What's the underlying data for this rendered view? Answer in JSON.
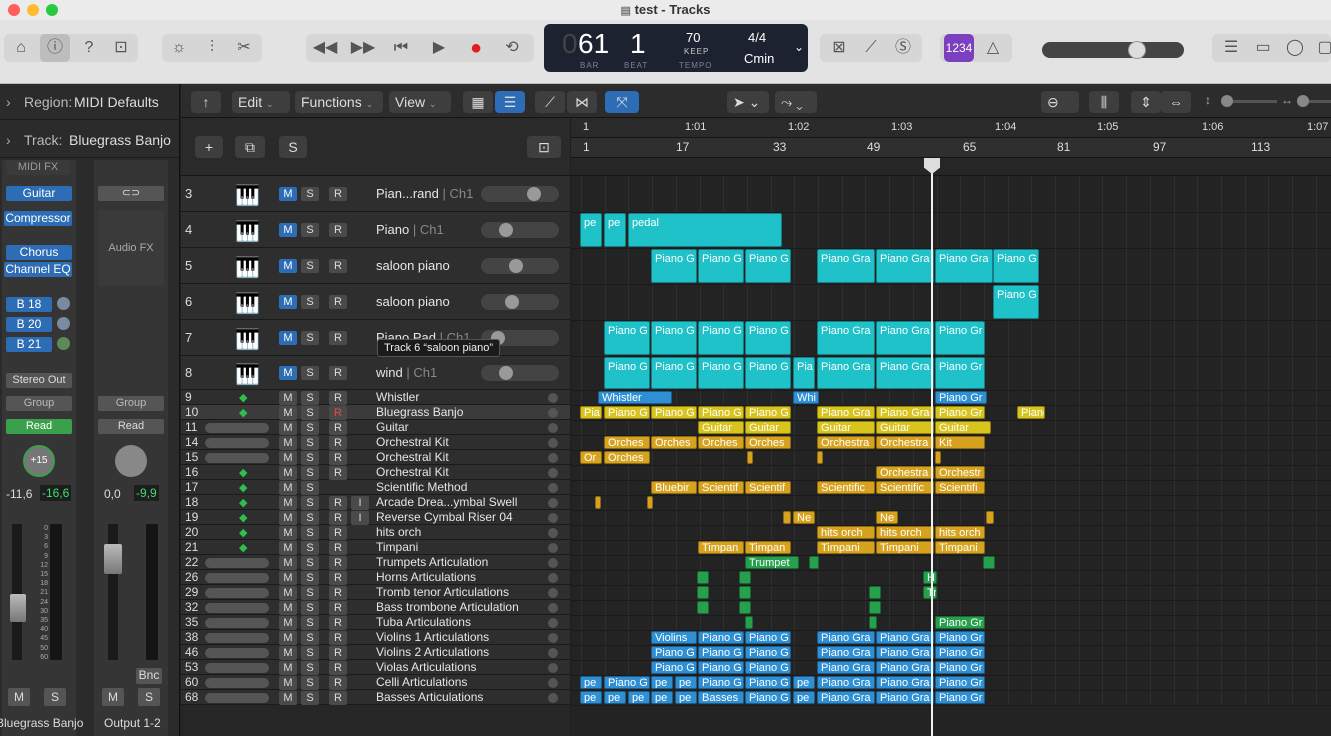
{
  "window": {
    "title": "test - Tracks"
  },
  "lcd": {
    "bar": "61",
    "beat": "1",
    "bar_lbl": "BAR",
    "beat_lbl": "BEAT",
    "tempo": "70",
    "keep": "KEEP",
    "tempo_lbl": "TEMPO",
    "sig": "4/4",
    "key": "Cmin",
    "prefix": "0"
  },
  "count_in": "1234",
  "inspector": {
    "region_lbl": "Region:",
    "region_val": "MIDI Defaults",
    "track_lbl": "Track:",
    "track_val": "Bluegrass Banjo",
    "midi_fx": "MIDI FX",
    "plugins": [
      "Guitar",
      "Compressor",
      "Chorus",
      "Channel EQ"
    ],
    "sends": [
      "B 18",
      "B 20",
      "B 21"
    ],
    "stereo_out": "Stereo Out",
    "group": "Group",
    "group2": "Group",
    "read": "Read",
    "read2": "Read",
    "pan": "+15",
    "vol_l": "-11,6",
    "vol_r": "-16,6",
    "vol2_l": "0,0",
    "vol2_r": "-9,9",
    "audio_fx": "Audio FX",
    "bnc": "Bnc",
    "m": "M",
    "s": "S",
    "strip1_name": "Bluegrass Banjo",
    "strip2_name": "Output 1-2",
    "db_scale": [
      "0",
      "3",
      "6",
      "9",
      "12",
      "15",
      "18",
      "21",
      "24",
      "30",
      "35",
      "40",
      "45",
      "50",
      "60"
    ]
  },
  "toolbar": {
    "edit": "Edit",
    "functions": "Functions",
    "view": "View"
  },
  "header_buttons": {
    "plus": "+",
    "s": "S"
  },
  "ruler_time": [
    "1",
    "1:01",
    "1:02",
    "1:03",
    "1:04",
    "1:05",
    "1:06",
    "1:07"
  ],
  "ruler_bars": [
    "1",
    "17",
    "33",
    "49",
    "65",
    "81",
    "97",
    "113"
  ],
  "tooltip": "Track 6 “saloon piano”",
  "btn": {
    "m": "M",
    "s": "S",
    "r": "R",
    "i": "I"
  },
  "tracks": [
    {
      "num": "3",
      "name": "Pian...rand",
      "ch": " | Ch1"
    },
    {
      "num": "4",
      "name": "Piano",
      "ch": " | Ch1"
    },
    {
      "num": "5",
      "name": "saloon piano",
      "ch": ""
    },
    {
      "num": "6",
      "name": "saloon piano",
      "ch": ""
    },
    {
      "num": "7",
      "name": "Piano Pad",
      "ch": " | Ch1"
    },
    {
      "num": "8",
      "name": "wind",
      "ch": " | Ch1"
    },
    {
      "num": "9",
      "name": "Whistler",
      "ch": ""
    },
    {
      "num": "10",
      "name": "Bluegrass Banjo",
      "ch": ""
    },
    {
      "num": "11",
      "name": "Guitar",
      "ch": ""
    },
    {
      "num": "14",
      "name": "Orchestral Kit",
      "ch": ""
    },
    {
      "num": "15",
      "name": "Orchestral Kit",
      "ch": ""
    },
    {
      "num": "16",
      "name": "Orchestral Kit",
      "ch": ""
    },
    {
      "num": "17",
      "name": "Scientific Method",
      "ch": ""
    },
    {
      "num": "18",
      "name": "Arcade Drea...ymbal Swell",
      "ch": ""
    },
    {
      "num": "19",
      "name": "Reverse Cymbal Riser 04",
      "ch": ""
    },
    {
      "num": "20",
      "name": "hits orch",
      "ch": ""
    },
    {
      "num": "21",
      "name": "Timpani",
      "ch": ""
    },
    {
      "num": "22",
      "name": "Trumpets Articulation",
      "ch": ""
    },
    {
      "num": "26",
      "name": "Horns Articulations",
      "ch": ""
    },
    {
      "num": "29",
      "name": "Tromb tenor Articulations",
      "ch": ""
    },
    {
      "num": "32",
      "name": "Bass trombone Articulation",
      "ch": ""
    },
    {
      "num": "35",
      "name": "Tuba Articulations",
      "ch": ""
    },
    {
      "num": "38",
      "name": "Violins 1 Articulations",
      "ch": ""
    },
    {
      "num": "46",
      "name": "Violins 2 Articulations",
      "ch": ""
    },
    {
      "num": "53",
      "name": "Violas Articulations",
      "ch": ""
    },
    {
      "num": "60",
      "name": "Celli Articulations",
      "ch": ""
    },
    {
      "num": "68",
      "name": "Basses Articulations",
      "ch": ""
    }
  ],
  "regions": [
    [
      "pe",
      "pe",
      "pedal"
    ],
    [
      "Piano G",
      "Piano G",
      "Piano G",
      "Piano Gra",
      "Piano Gra",
      "Piano Gra",
      "Piano G"
    ],
    [
      "Piano G"
    ],
    [
      "Piano G",
      "Piano G",
      "Piano G",
      "Piano G",
      "Piano Gra",
      "Piano Gra",
      "Piano Gr"
    ],
    [
      "Piano G",
      "Piano G",
      "Piano G",
      "Piano G",
      "Pia",
      "Piano Gra",
      "Piano Gra",
      "Piano Gr"
    ],
    [
      "Whistler",
      "Whi",
      "Piano Gr"
    ],
    [
      "Pia",
      "Piano G",
      "Piano G",
      "Piano G",
      "Piano G",
      "Piano Gra",
      "Piano Gra",
      "Piano Gr",
      "Piano Gr"
    ],
    [
      "Guitar",
      "Guitar",
      "Guitar",
      "Guitar",
      "Guitar"
    ],
    [
      "Orches",
      "Orches",
      "Orches",
      "Orches",
      "Orchestra",
      "Orchestra",
      "Kit"
    ],
    [
      "Or",
      "Orches"
    ],
    [
      "Orchestra",
      "Orchestr"
    ],
    [
      "Bluebir",
      "Scientif",
      "Scientif",
      "Scientific",
      "Scientific",
      "Scientifi"
    ],
    [
      "Ne",
      "Ne"
    ],
    [
      "hits orch",
      "hits orch",
      "hits orch"
    ],
    [
      "Timpan",
      "Timpan",
      "Timpani",
      "Timpani",
      "Timpani"
    ],
    [
      "Trumpet"
    ],
    [
      "H"
    ],
    [
      "Tr"
    ],
    [
      "Piano Gr"
    ],
    [
      "Violins",
      "Piano G",
      "Piano G",
      "Piano Gra",
      "Piano Gra",
      "Piano Gr"
    ],
    [
      "Piano G",
      "Piano G",
      "Piano G",
      "Piano Gra",
      "Piano Gra",
      "Piano Gr"
    ],
    [
      "Piano G",
      "Piano G",
      "Piano G",
      "Piano Gra",
      "Piano Gra",
      "Piano Gr"
    ],
    [
      "pe",
      "Piano G",
      "pe",
      "pe",
      "Piano G",
      "Piano G",
      "pe",
      "Piano Gra",
      "Piano Gra",
      "Piano Gr"
    ],
    [
      "pe",
      "pe",
      "pe",
      "pe",
      "pe",
      "Basses",
      "Piano G",
      "pe",
      "Piano Gra",
      "Piano Gra",
      "Piano Gr"
    ]
  ],
  "colors": {
    "cyan": "#1fc2c9",
    "yellow": "#d8c41c",
    "gold": "#d7a21e",
    "blue": "#2e8fd4",
    "green": "#27a04e",
    "accent": "#2d6db5",
    "purple": "#7b3fbf"
  }
}
